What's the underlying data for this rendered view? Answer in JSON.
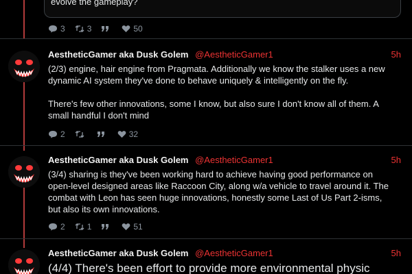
{
  "quoted": {
    "text": "evolve the gameplay?"
  },
  "top_actions": {
    "replies": "3",
    "retweets": "3",
    "likes": "50"
  },
  "tweets": [
    {
      "name": "AestheticGamer aka Dusk Golem",
      "handle": "@AestheticGamer1",
      "time": "5h",
      "p1": "(2/3) engine, hair engine from Pragmata. Additionally we know the stalker uses a new dynamic AI system they've done to behave uniquely & intelligently on the fly.",
      "p2": "There's  few other innovations, some I know, but also sure I don't know all of them. A small handful I don't mind",
      "replies": "2",
      "retweets": "",
      "likes": "32"
    },
    {
      "name": "AestheticGamer aka Dusk Golem",
      "handle": "@AestheticGamer1",
      "time": "5h",
      "p1": "(3/4) sharing is they've been working hard to achieve having good performance on open-level designed areas like Raccoon City, along w/a vehicle to travel around it. The combat with Leon has seen huge innovations, honestly some Last of Us Part 2-isms, but also its own innovations.",
      "replies": "2",
      "retweets": "1",
      "likes": "51"
    },
    {
      "name": "AestheticGamer aka Dusk Golem",
      "handle": "@AestheticGamer1",
      "time": "5h",
      "p1": "(4/4) There's been effort to provide more environmental physic"
    }
  ],
  "colors": {
    "accent": "#e33333",
    "thread": "#b23b3b",
    "muted": "#8b949e"
  },
  "icons": [
    "reply-icon",
    "retweet-icon",
    "quote-icon",
    "like-icon"
  ]
}
